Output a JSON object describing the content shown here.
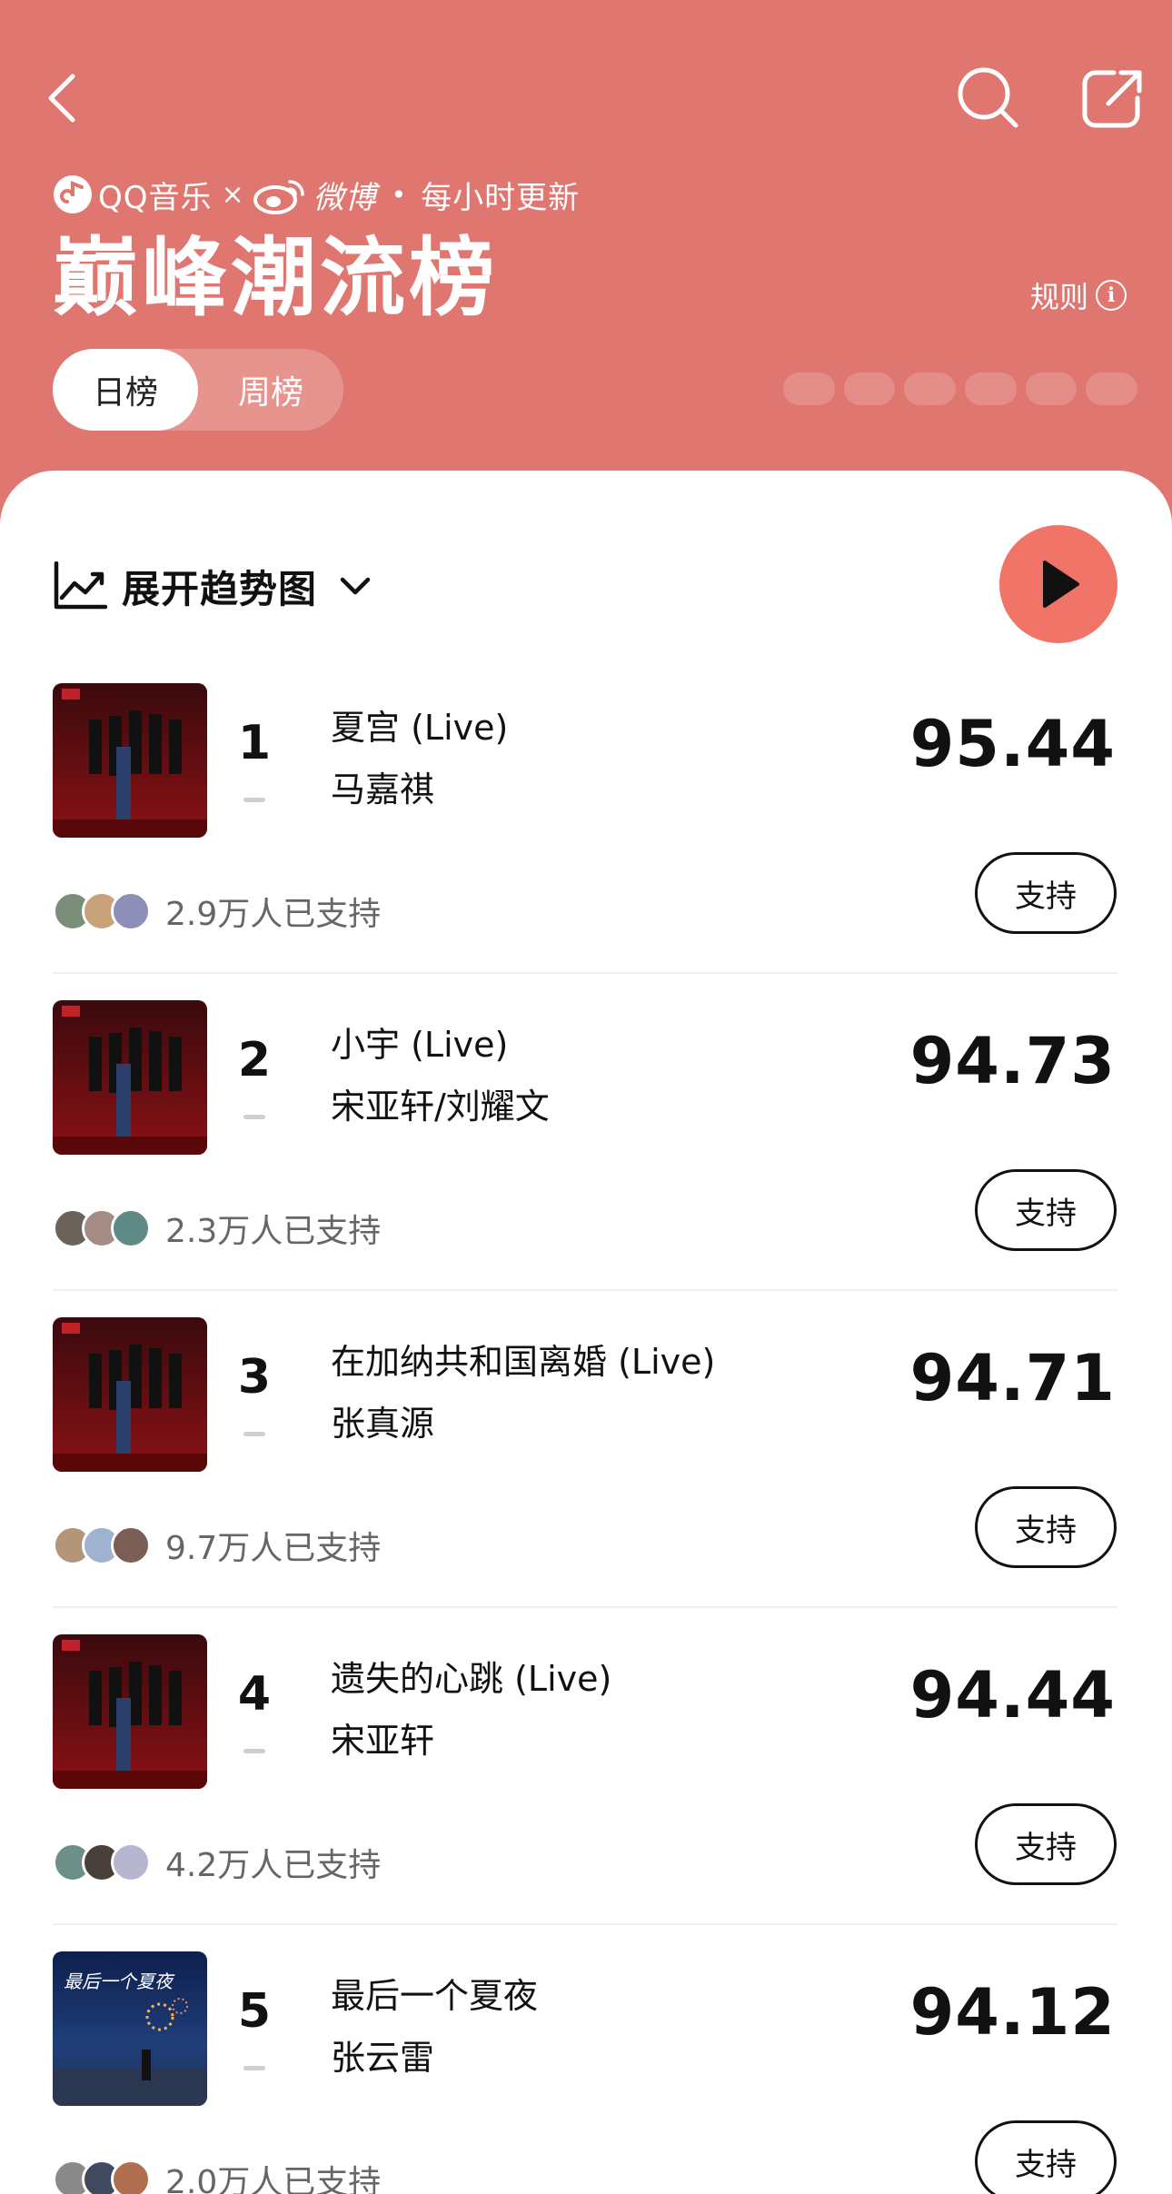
{
  "header": {
    "brand_qq": "QQ音乐",
    "brand_times": "×",
    "brand_weibo": "微博",
    "brand_dot": "•",
    "brand_update": "每小时更新",
    "title": "巅峰潮流榜",
    "rules_label": "规则",
    "rules_icon": "info-icon",
    "tabs": [
      {
        "label": "日榜",
        "selected": true
      },
      {
        "label": "周榜",
        "selected": false
      }
    ],
    "colors": {
      "background": "#e07670",
      "text": "#ffffff"
    }
  },
  "controls": {
    "trend_label": "展开趋势图",
    "trend_icon": "trend-chart-icon",
    "expand_icon": "chevron-down-icon",
    "play_icon": "play-icon",
    "play_color": "#f07468"
  },
  "chart": [
    {
      "rank": "1",
      "title": "夏宫 (Live)",
      "artist": "马嘉祺",
      "score": "95.44",
      "supporters": "2.9万人已支持",
      "support_label": "支持",
      "cover": "album-cover-dark-red"
    },
    {
      "rank": "2",
      "title": "小宇 (Live)",
      "artist": "宋亚轩/刘耀文",
      "score": "94.73",
      "supporters": "2.3万人已支持",
      "support_label": "支持",
      "cover": "album-cover-dark-red"
    },
    {
      "rank": "3",
      "title": "在加纳共和国离婚 (Live)",
      "artist": "张真源",
      "score": "94.71",
      "supporters": "9.7万人已支持",
      "support_label": "支持",
      "cover": "album-cover-dark-red"
    },
    {
      "rank": "4",
      "title": "遗失的心跳 (Live)",
      "artist": "宋亚轩",
      "score": "94.44",
      "supporters": "4.2万人已支持",
      "support_label": "支持",
      "cover": "album-cover-dark-red"
    },
    {
      "rank": "5",
      "title": "最后一个夏夜",
      "artist": "张云雷",
      "score": "94.12",
      "supporters": "2.0万人已支持",
      "support_label": "支持",
      "cover": "album-cover-night-sky",
      "cover_text": "最后一个夏夜"
    }
  ]
}
